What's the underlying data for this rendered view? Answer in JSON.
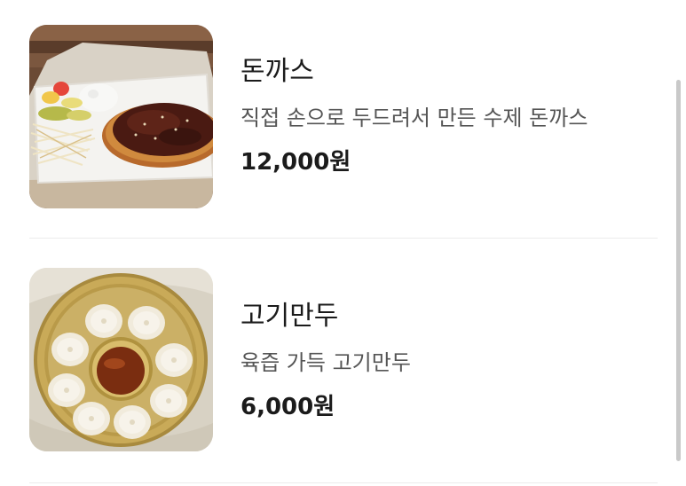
{
  "menu": {
    "items": [
      {
        "name": "돈까스",
        "description": "직접 손으로 두드려서 만든 수제 돈까스",
        "price": "12,000원",
        "image_icon": "pork-cutlet-photo-icon"
      },
      {
        "name": "고기만두",
        "description": "육즙 가득 고기만두",
        "price": "6,000원",
        "image_icon": "dumplings-photo-icon"
      }
    ]
  },
  "colors": {
    "background": "#ffffff",
    "text_primary": "#1b1b1b",
    "text_secondary": "#555555",
    "divider": "#ececec",
    "scrollbar": "#c9c9c9"
  }
}
